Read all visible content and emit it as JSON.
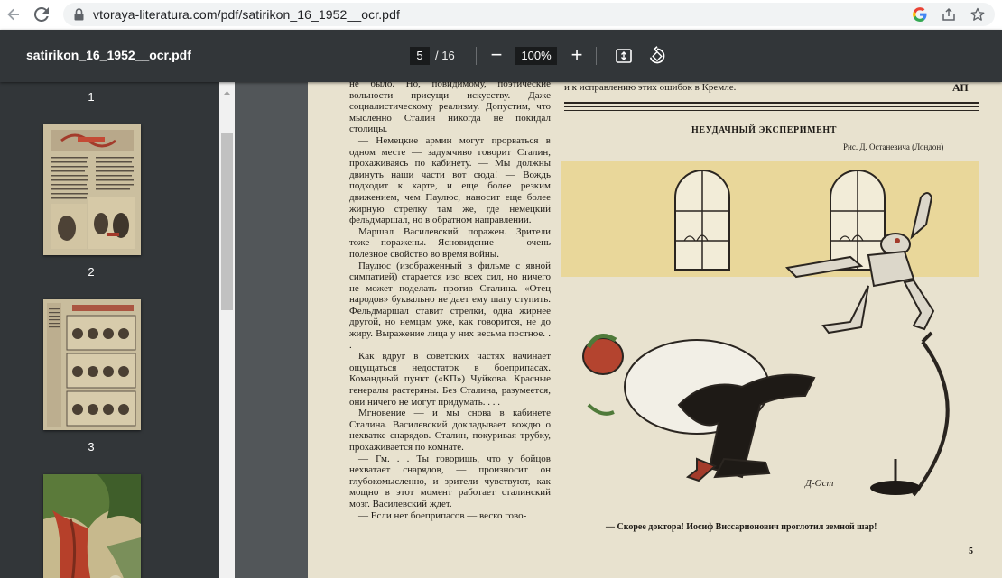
{
  "browser": {
    "url": "vtoraya-literatura.com/pdf/satirikon_16_1952__ocr.pdf",
    "icons": [
      "back-arrow-icon",
      "reload-icon",
      "lock-icon",
      "google-icon",
      "share-icon",
      "star-icon"
    ]
  },
  "toolbar": {
    "filename": "satirikon_16_1952__ocr.pdf",
    "current_page": "5",
    "total_pages": "/ 16",
    "zoom_out": "−",
    "zoom": "100%",
    "zoom_in": "+"
  },
  "sidebar": {
    "thumbnails": [
      {
        "label": "1"
      },
      {
        "label": "2"
      },
      {
        "label": "3"
      }
    ]
  },
  "page": {
    "left_column": [
      "не было. Но, повидимому, поэтические вольности присущи искусству. Даже социалистическому реализму. Допустим, что мысленно Сталин никогда не покидал столицы.",
      "— Немецкие армии могут прорваться в одном месте — задумчиво говорит Сталин, прохаживаясь по кабинету. — Мы должны двинуть наши части вот сюда! — Вождь подходит к карте, и еще более резким движением, чем Паулюс, наносит еще более жирную стрелку там же, где немецкий фельдмаршал, но в обратном направлении.",
      "Маршал Василевский поражен. Зрители тоже поражены. Ясновидение — очень полезное свойство во время войны.",
      "Паулюс (изображенный в фильме с явной симпатией) старается изо всех сил, но ничего не может поделать против Сталина. «Отец народов» буквально не дает ему шагу ступить. Фельдмаршал ставит стрелки, одна жирнее другой, но немцам уже, как говорится, не до жиру. Выражение лица у них весьма постное. . .",
      "Как вдруг в советских частях начинает ощущаться недостаток в боеприпасах. Командный пункт («КП») Чуйкова. Красные генералы растеряны. Без Сталина, разумеется, они ничего не могут придумать. . . .",
      "Мгновение — и мы снова в кабинете Сталина. Василевский докладывает вождю о нехватке снарядов. Сталин, покуривая трубку, прохаживается по комнате.",
      "— Гм. . . Ты говоришь, что у бойцов нехватает снарядов, — произносит он глубокомысленно, и зрители чувствуют, как мощно в этот момент работает сталинский мозг. Василевский ждет.",
      "— Если нет боеприпасов — веско гово-"
    ],
    "right_top_text": "и к исправлению этих ошибок в Кремле.",
    "right_top_mark": "АП",
    "art_title": "НЕУДАЧНЫЙ ЭКСПЕРИМЕНТ",
    "art_credit": "Рис. Д. Останевича (Лондон)",
    "signature": "Д-Ост",
    "caption": "— Скорее доктора! Иосиф Виссарионович проглотил земной шар!",
    "page_number": "5"
  },
  "colors": {
    "toolbar_bg": "#323639",
    "viewer_bg": "#525659",
    "paper": "#e8e2cf",
    "illustration_bg": "#e9d79a"
  }
}
